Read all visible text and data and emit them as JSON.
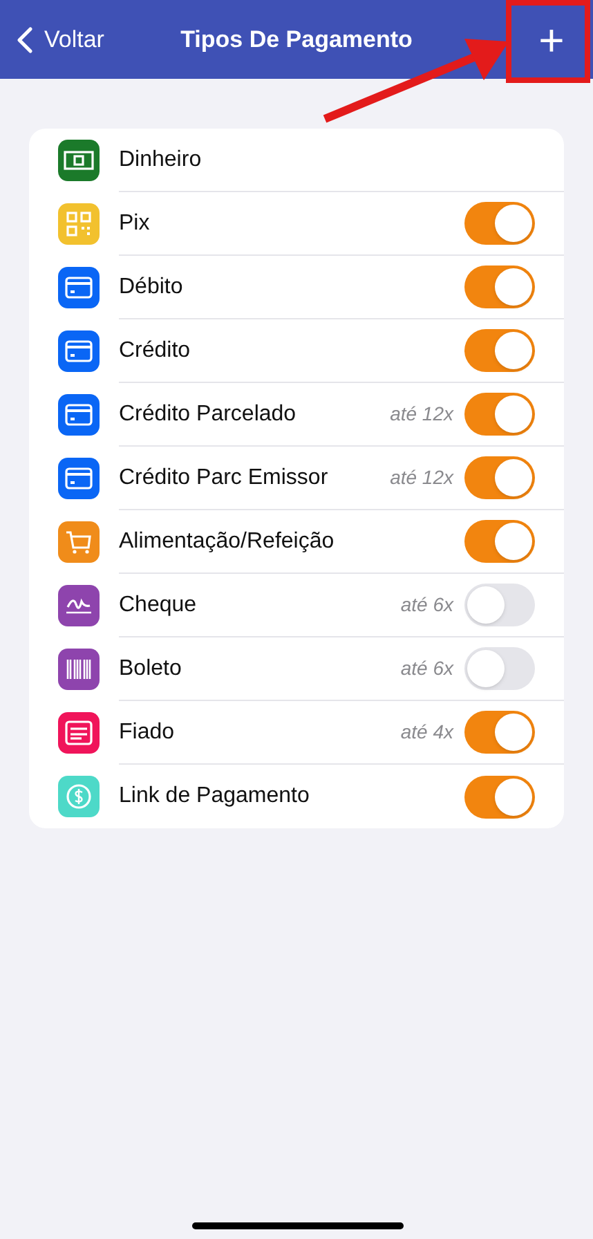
{
  "nav": {
    "back": "Voltar",
    "title": "Tipos De Pagamento",
    "add": "+"
  },
  "payment_types": [
    {
      "label": "Dinheiro",
      "kind": "cash",
      "color": "#1b7a2a"
    },
    {
      "label": "Pix",
      "kind": "qr",
      "color": "#f2c12e",
      "on": true
    },
    {
      "label": "Débito",
      "kind": "card",
      "color": "#0a66f5",
      "on": true
    },
    {
      "label": "Crédito",
      "kind": "card",
      "color": "#0a66f5",
      "on": true
    },
    {
      "label": "Crédito Parcelado",
      "kind": "card",
      "color": "#0a66f5",
      "installments": "até 12x",
      "on": true
    },
    {
      "label": "Crédito Parc Emissor",
      "kind": "card",
      "color": "#0a66f5",
      "installments": "até 12x",
      "on": true
    },
    {
      "label": "Alimentação/Refeição",
      "kind": "cart",
      "color": "#f08c1a",
      "on": true
    },
    {
      "label": "Cheque",
      "kind": "signature",
      "color": "#8e44ad",
      "installments": "até 6x",
      "on": false
    },
    {
      "label": "Boleto",
      "kind": "barcode",
      "color": "#8e44ad",
      "installments": "até 6x",
      "on": false
    },
    {
      "label": "Fiado",
      "kind": "note",
      "color": "#f0145a",
      "installments": "até 4x",
      "on": true
    },
    {
      "label": "Link de Pagamento",
      "kind": "coin",
      "color": "#4dd9c8",
      "on": true
    }
  ]
}
